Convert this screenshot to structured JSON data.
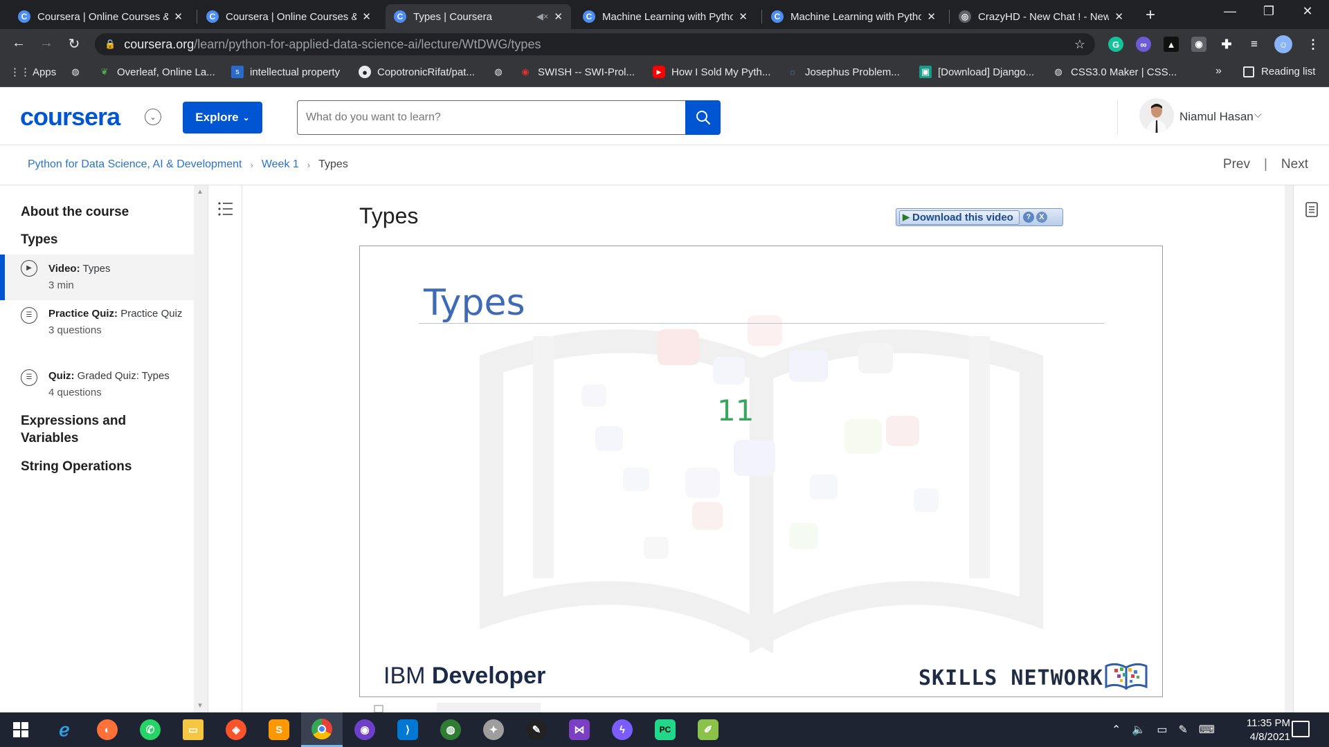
{
  "browser": {
    "tabs": [
      {
        "title": "Coursera | Online Courses & Cr",
        "icon": "coursera-favicon",
        "active": false
      },
      {
        "title": "Coursera | Online Courses & Cr",
        "icon": "coursera-favicon",
        "active": false
      },
      {
        "title": "Types | Coursera",
        "icon": "coursera-favicon",
        "active": true
      },
      {
        "title": "Machine Learning with Python",
        "icon": "coursera-favicon",
        "active": false
      },
      {
        "title": "Machine Learning with Python",
        "icon": "coursera-favicon",
        "active": false
      },
      {
        "title": "CrazyHD - New Chat ! - New",
        "icon": "globe-favicon",
        "active": false
      }
    ],
    "address": {
      "host": "coursera.org",
      "path": "/learn/python-for-applied-data-science-ai/lecture/WtDWG/types"
    },
    "bookmarks": [
      {
        "label": "Apps",
        "icon": "apps-grid-icon"
      },
      {
        "label": "",
        "icon": "globe-icon"
      },
      {
        "label": "Overleaf, Online La...",
        "icon": "overleaf-icon"
      },
      {
        "label": "intellectual property",
        "icon": "s-badge-icon"
      },
      {
        "label": "CopotronicRifat/pat...",
        "icon": "github-icon"
      },
      {
        "label": "",
        "icon": "globe-icon"
      },
      {
        "label": "SWISH -- SWI-Prol...",
        "icon": "swish-icon"
      },
      {
        "label": "How I Sold My Pyth...",
        "icon": "youtube-icon"
      },
      {
        "label": "Josephus Problem...",
        "icon": "loading-icon"
      },
      {
        "label": "[Download] Django...",
        "icon": "django-icon"
      },
      {
        "label": "CSS3.0 Maker | CSS...",
        "icon": "globe-icon"
      }
    ],
    "more_label": "»",
    "reading_list": "Reading list"
  },
  "header": {
    "logo": "coursera",
    "explore_label": "Explore",
    "search_placeholder": "What do you want to learn?",
    "user_name": "Niamul Hasan"
  },
  "breadcrumb": {
    "items": [
      "Python for Data Science, AI & Development",
      "Week 1",
      "Types"
    ],
    "prev": "Prev",
    "next": "Next"
  },
  "sidebar": {
    "about": "About the course",
    "section": "Types",
    "items": [
      {
        "kind": "Video:",
        "name": "Types",
        "meta": "3 min",
        "icon": "play-circle-icon",
        "active": true
      },
      {
        "kind": "Practice Quiz:",
        "name": "Practice Quiz",
        "meta": "3 questions",
        "icon": "quiz-icon",
        "active": false
      },
      {
        "kind": "Quiz:",
        "name": "Graded Quiz: Types",
        "meta": "4 questions",
        "icon": "quiz-icon",
        "active": false
      }
    ],
    "sections_after": [
      "Expressions and Variables",
      "String Operations"
    ]
  },
  "lecture": {
    "title": "Types",
    "download_label": "Download this video",
    "help_label": "?",
    "close_label": "X"
  },
  "video": {
    "slide_title": "Types",
    "slide_value": "11",
    "brand_left_light": "IBM ",
    "brand_left_bold": "Developer",
    "brand_right": "SKILLS NETWORK"
  },
  "taskbar": {
    "apps": [
      "windows-start",
      "edge-old",
      "firefox",
      "whatsapp",
      "file-explorer",
      "brave",
      "sublime",
      "chrome",
      "github-desktop",
      "vscode",
      "earth",
      "parrot",
      "inkscape",
      "visual-studio",
      "messenger",
      "pycharm",
      "notepad-plus"
    ],
    "time": "11:35 PM",
    "date": "4/8/2021"
  },
  "colors": {
    "coursera_blue": "#0056d2",
    "link_blue": "#2a73cc",
    "slide_title": "#3e6ab6",
    "slide_value": "#3aa55c"
  }
}
